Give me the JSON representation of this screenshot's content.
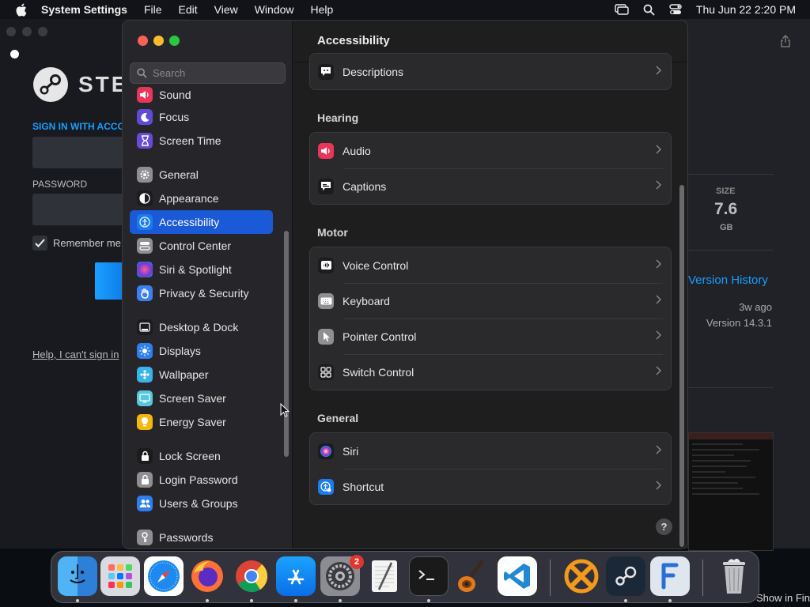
{
  "menubar": {
    "app_name": "System Settings",
    "menus": [
      "File",
      "Edit",
      "View",
      "Window",
      "Help"
    ],
    "datetime": "Thu Jun 22  2:20 PM",
    "status_icons": [
      "screen-mirroring-icon",
      "spotlight-search-icon",
      "control-center-icon"
    ]
  },
  "steam": {
    "logo_text": "STEA",
    "signin_label": "SIGN IN WITH ACCO",
    "password_label": "PASSWORD",
    "remember_label": "Remember me",
    "help_link": "Help, I can't sign in"
  },
  "background_window": {
    "size_label": "SIZE",
    "size_value": "7.6",
    "size_unit": "GB",
    "version_history_link": "Version History",
    "updated_ago": "3w ago",
    "version": "Version 14.3.1",
    "show_in_finder": "Show in Finde"
  },
  "settings": {
    "search_placeholder": "Search",
    "title": "Accessibility",
    "sidebar": {
      "items": [
        {
          "label": "Sound",
          "icon": "sound-icon",
          "color": "#e6365a"
        },
        {
          "label": "Focus",
          "icon": "moon-icon",
          "color": "#5e4bd6"
        },
        {
          "label": "Screen Time",
          "icon": "hourglass-icon",
          "color": "#6a4bd6"
        },
        {
          "label": "General",
          "icon": "gear-icon",
          "color": "#8e8e93"
        },
        {
          "label": "Appearance",
          "icon": "appearance-icon",
          "color": "#1c1c1e"
        },
        {
          "label": "Accessibility",
          "icon": "accessibility-icon",
          "color": "#1b7cf0",
          "active": true
        },
        {
          "label": "Control Center",
          "icon": "control-center-icon",
          "color": "#8e8e93"
        },
        {
          "label": "Siri & Spotlight",
          "icon": "siri-icon",
          "color": "#c03adf"
        },
        {
          "label": "Privacy & Security",
          "icon": "hand-icon",
          "color": "#3b7ff0"
        },
        {
          "label": "Desktop & Dock",
          "icon": "dock-icon",
          "color": "#1c1c1e"
        },
        {
          "label": "Displays",
          "icon": "displays-icon",
          "color": "#2f7ff0"
        },
        {
          "label": "Wallpaper",
          "icon": "wallpaper-icon",
          "color": "#38b4e8"
        },
        {
          "label": "Screen Saver",
          "icon": "screen-saver-icon",
          "color": "#55c8e0"
        },
        {
          "label": "Energy Saver",
          "icon": "bulb-icon",
          "color": "#f5b50a"
        },
        {
          "label": "Lock Screen",
          "icon": "lock-icon",
          "color": "#1c1c1e"
        },
        {
          "label": "Login Password",
          "icon": "lock-icon",
          "color": "#8e8e93"
        },
        {
          "label": "Users & Groups",
          "icon": "users-icon",
          "color": "#2f7ff0"
        },
        {
          "label": "Passwords",
          "icon": "key-icon",
          "color": "#8e8e93"
        }
      ]
    },
    "sections": [
      {
        "heading": "",
        "rows": [
          {
            "label": "Descriptions",
            "icon": "descriptions-icon",
            "color": "#1c1c1e"
          }
        ]
      },
      {
        "heading": "Hearing",
        "rows": [
          {
            "label": "Audio",
            "icon": "speaker-icon",
            "color": "#e6365a"
          },
          {
            "label": "Captions",
            "icon": "captions-icon",
            "color": "#1c1c1e"
          }
        ]
      },
      {
        "heading": "Motor",
        "rows": [
          {
            "label": "Voice Control",
            "icon": "voice-control-icon",
            "color": "#1c1c1e"
          },
          {
            "label": "Keyboard",
            "icon": "keyboard-icon",
            "color": "#8e8e93"
          },
          {
            "label": "Pointer Control",
            "icon": "pointer-icon",
            "color": "#8e8e93"
          },
          {
            "label": "Switch Control",
            "icon": "switch-control-icon",
            "color": "#1c1c1e"
          }
        ]
      },
      {
        "heading": "General",
        "rows": [
          {
            "label": "Siri",
            "icon": "siri-icon",
            "color": "#1c1c1e"
          },
          {
            "label": "Shortcut",
            "icon": "accessibility-shortcut-icon",
            "color": "#1b7cf0"
          }
        ]
      }
    ],
    "help_symbol": "?"
  },
  "dock": {
    "apps": [
      "Finder",
      "Launchpad",
      "Safari",
      "Firefox",
      "Chrome",
      "App Store",
      "System Settings",
      "TextEdit",
      "Terminal",
      "GarageBand",
      "Visual Studio Code",
      "CrossOver",
      "Steam",
      "Fork",
      "Trash"
    ],
    "system_settings_badge": "2"
  }
}
